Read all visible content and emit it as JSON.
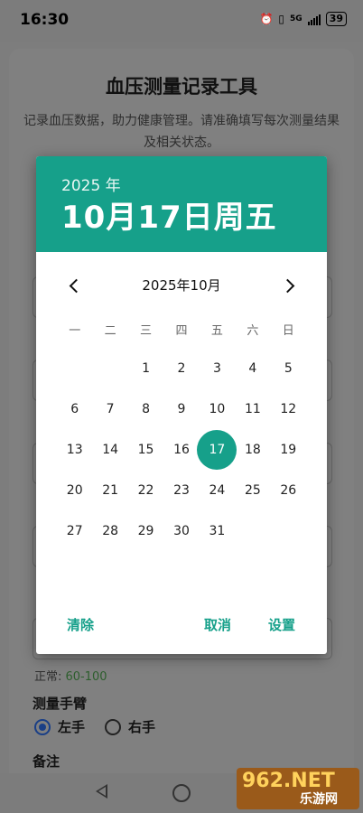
{
  "status": {
    "time": "16:30",
    "battery": "39",
    "network": "5G"
  },
  "page": {
    "title": "血压测量记录工具",
    "subtitle": "记录血压数据，助力健康管理。请准确填写每次测量结果及相关状态。",
    "normal_prefix": "正常: ",
    "normal_range": "60-100",
    "arm_label": "测量手臂",
    "arm_options": [
      "左手",
      "右手"
    ],
    "note_label": "备注"
  },
  "dialog": {
    "year": "2025 年",
    "date": "10月17日周五",
    "month": "2025年10月",
    "weekdays": [
      "一",
      "二",
      "三",
      "四",
      "五",
      "六",
      "日"
    ],
    "leading_blanks": 2,
    "days": [
      "1",
      "2",
      "3",
      "4",
      "5",
      "6",
      "7",
      "8",
      "9",
      "10",
      "11",
      "12",
      "13",
      "14",
      "15",
      "16",
      "17",
      "18",
      "19",
      "20",
      "21",
      "22",
      "23",
      "24",
      "25",
      "26",
      "27",
      "28",
      "29",
      "30",
      "31"
    ],
    "selected": "17",
    "clear_label": "清除",
    "cancel_label": "取消",
    "set_label": "设置"
  },
  "watermark": {
    "brand": "962.NET",
    "site": "乐游网"
  }
}
